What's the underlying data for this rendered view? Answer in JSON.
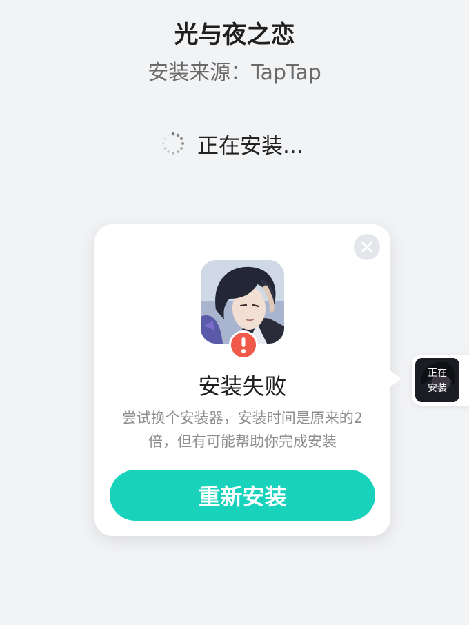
{
  "app": {
    "title": "光与夜之恋",
    "source": "安装来源：TapTap"
  },
  "status": {
    "text": "正在安装..."
  },
  "dialog": {
    "title": "安装失败",
    "description": "尝试换个安装器，安装时间是原来的2倍，但有可能帮助你完成安装",
    "button_label": "重新安装"
  },
  "floating_widget": {
    "label": "正在\n安装"
  },
  "colors": {
    "accent": "#18d2bb",
    "error": "#f15a4a",
    "background": "#f2f3f5"
  },
  "icons": {
    "close": "close-icon",
    "spinner": "spinner-icon",
    "error": "exclamation-icon",
    "app": "app-icon"
  }
}
